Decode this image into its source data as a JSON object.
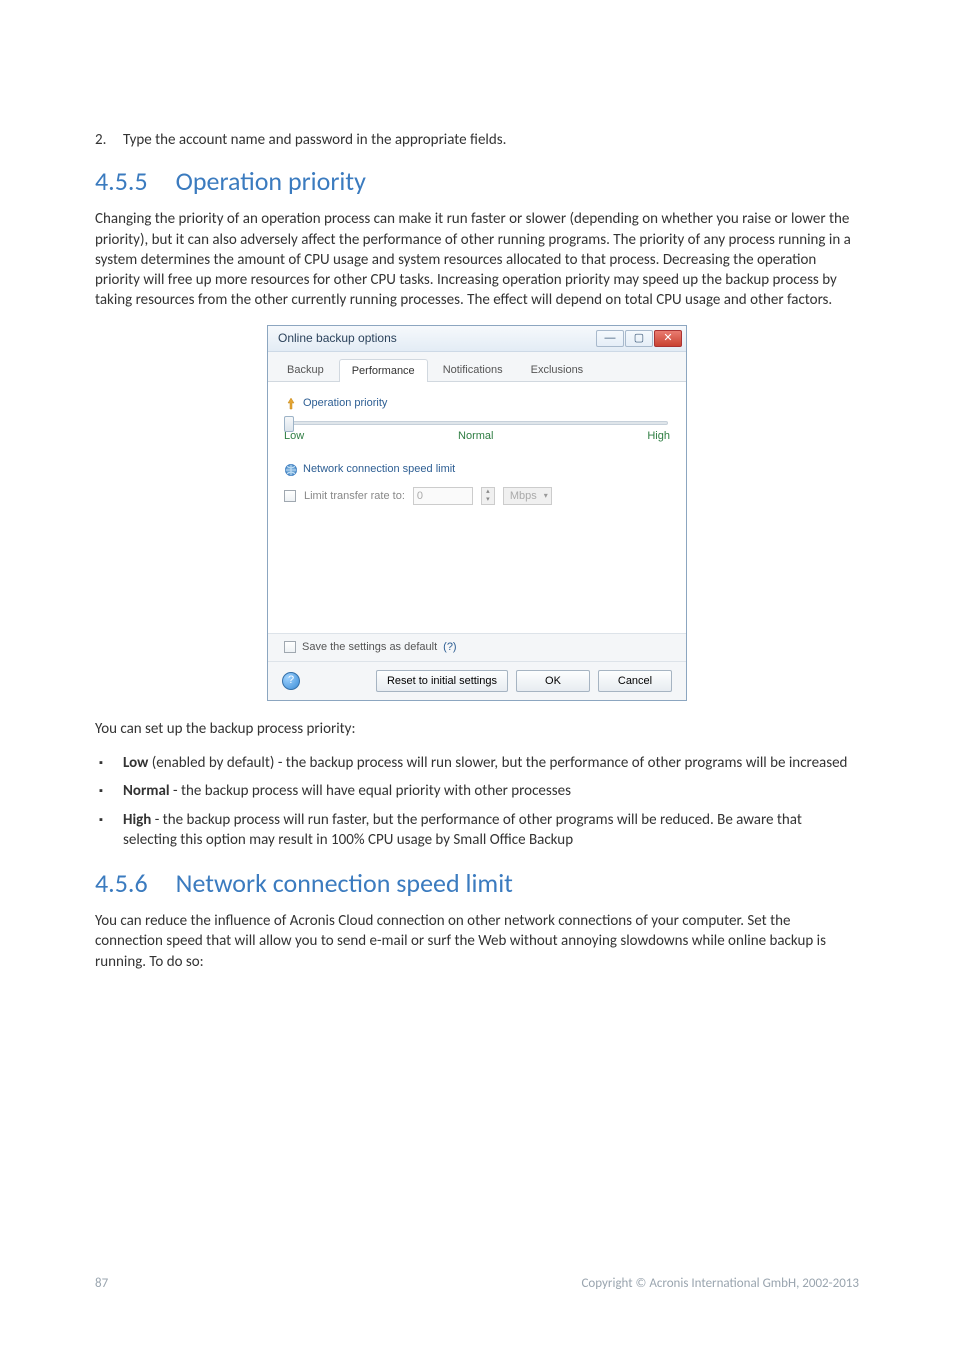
{
  "step2": {
    "num": "2.",
    "text": "Type the account name and password in the appropriate fields."
  },
  "section455": {
    "num": "4.5.5",
    "title": "Operation priority"
  },
  "para455": "Changing the priority of an operation process can make it run faster or slower (depending on whether you raise or lower the priority), but it can also adversely affect the performance of other running programs. The priority of any process running in a system determines the amount of CPU usage and system resources allocated to that process. Decreasing the operation priority will free up more resources for other CPU tasks. Increasing operation priority may speed up the backup process by taking resources from the other currently running processes. The effect will depend on total CPU usage and other factors.",
  "dialog": {
    "title": "Online backup options",
    "tabs": {
      "backup": "Backup",
      "performance": "Performance",
      "notifications": "Notifications",
      "exclusions": "Exclusions"
    },
    "opPriority": "Operation priority",
    "slider": {
      "low": "Low",
      "normal": "Normal",
      "high": "High"
    },
    "netLimit": "Network connection speed limit",
    "limitLabel": "Limit transfer rate to:",
    "limitValue": "0",
    "limitUnit": "Mbps",
    "saveDefault": "Save the settings as default",
    "saveHelp": "(?)",
    "resetBtn": "Reset to initial settings",
    "okBtn": "OK",
    "cancelBtn": "Cancel"
  },
  "afterDialog": "You can set up the backup process priority:",
  "bullets455": [
    {
      "bold": "Low",
      "rest": " (enabled by default) - the backup process will run slower, but the performance of other programs will be increased"
    },
    {
      "bold": "Normal",
      "rest": " - the backup process will have equal priority with other processes"
    },
    {
      "bold": "High",
      "rest": " - the backup process will run faster, but the performance of other programs will be reduced. Be aware that selecting this option may result in 100% CPU usage by Small Office Backup"
    }
  ],
  "section456": {
    "num": "4.5.6",
    "title": "Network connection speed limit"
  },
  "para456": "You can reduce the influence of Acronis Cloud connection on other network connections of your computer. Set the connection speed that will allow you to send e-mail or surf the Web without annoying slowdowns while online backup is running. To do so:",
  "footer": {
    "page": "87",
    "copy": "Copyright © Acronis International GmbH, 2002-2013"
  }
}
